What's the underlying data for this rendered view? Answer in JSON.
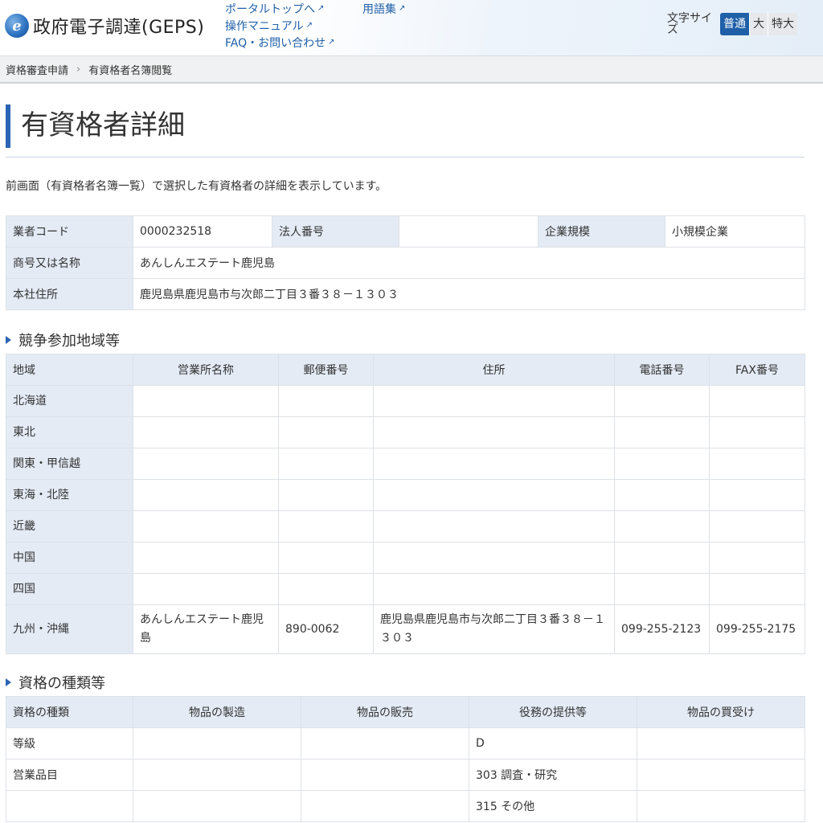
{
  "header": {
    "logo_mark": "e",
    "app_title": "政府電子調達(GEPS)",
    "links_col1": [
      "ポータルトップへ",
      "操作マニュアル",
      "FAQ・お問い合わせ"
    ],
    "links_col2": [
      "用語集"
    ],
    "ext_icon": "↗",
    "font_size": {
      "label": "文字サイズ",
      "options": [
        "普通",
        "大",
        "特大"
      ],
      "selected": "普通"
    }
  },
  "breadcrumb": [
    "資格審査申請",
    "有資格者名簿閲覧"
  ],
  "breadcrumb_sep": "›",
  "page_title": "有資格者詳細",
  "description": "前画面（有資格者名簿一覧）で選択した有資格者の詳細を表示しています。",
  "company": {
    "code_label": "業者コード",
    "code_value": "0000232518",
    "corp_no_label": "法人番号",
    "corp_no_value": "",
    "scale_label": "企業規模",
    "scale_value": "小規模企業",
    "name_label": "商号又は名称",
    "name_value": "あんしんエステート鹿児島",
    "address_label": "本社住所",
    "address_value": "鹿児島県鹿児島市与次郎二丁目３番３８－１３０３"
  },
  "regions": {
    "section_title": "競争参加地域等",
    "headers": [
      "地域",
      "営業所名称",
      "郵便番号",
      "住所",
      "電話番号",
      "FAX番号"
    ],
    "rows": [
      [
        "北海道",
        "",
        "",
        "",
        "",
        ""
      ],
      [
        "東北",
        "",
        "",
        "",
        "",
        ""
      ],
      [
        "関東・甲信越",
        "",
        "",
        "",
        "",
        ""
      ],
      [
        "東海・北陸",
        "",
        "",
        "",
        "",
        ""
      ],
      [
        "近畿",
        "",
        "",
        "",
        "",
        ""
      ],
      [
        "中国",
        "",
        "",
        "",
        "",
        ""
      ],
      [
        "四国",
        "",
        "",
        "",
        "",
        ""
      ],
      [
        "九州・沖縄",
        "あんしんエステート鹿児島",
        "890-0062",
        "鹿児島県鹿児島市与次郎二丁目３番３８－１３０３",
        "099-255-2123",
        "099-255-2175"
      ]
    ]
  },
  "qualifications": {
    "section_title": "資格の種類等",
    "headers": [
      "資格の種類",
      "物品の製造",
      "物品の販売",
      "役務の提供等",
      "物品の買受け"
    ],
    "rows": [
      [
        "等級",
        "",
        "",
        "D",
        ""
      ],
      [
        "営業品目",
        "",
        "",
        "303 調査・研究",
        ""
      ],
      [
        "",
        "",
        "",
        "315 その他",
        ""
      ]
    ]
  }
}
